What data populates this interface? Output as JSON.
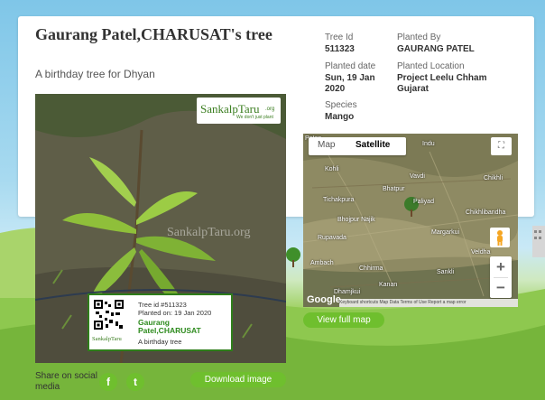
{
  "page": {
    "title": "Gaurang Patel,CHARUSAT's tree",
    "subtitle": "A birthday tree for Dhyan"
  },
  "details": {
    "tree_id_label": "Tree Id",
    "tree_id_value": "511323",
    "planted_by_label": "Planted By",
    "planted_by_value": "GAURANG PATEL",
    "planted_date_label": "Planted date",
    "planted_date_value_1": "Sun, 19 Jan",
    "planted_date_value_2": "2020",
    "planted_location_label": "Planted Location",
    "planted_location_value_1": "Project Leelu Chham",
    "planted_location_value_2": "Gujarat",
    "species_label": "Species",
    "species_value": "Mango"
  },
  "photo": {
    "logo_text": "SankalpTaru",
    "logo_tld": ".org",
    "logo_tagline": "We don't just plant",
    "watermark": "SankalpTaru.org"
  },
  "tag": {
    "tree_id": "Tree id #511323",
    "planted_on": "Planted on: 19 Jan 2020",
    "name": "Gaurang Patel,CHARUSAT",
    "occasion": "A birthday tree",
    "logo": "SankalpTaru"
  },
  "map": {
    "tab_map": "Map",
    "tab_satellite": "Satellite",
    "fullscreen_icon": "⛶",
    "zoom_in": "+",
    "zoom_out": "−",
    "google": "Google",
    "footer": "Keyboard shortcuts   Map Data   Terms of Use   Report a map error",
    "labels": [
      {
        "text": "Patan"
      },
      {
        "text": "Kohli"
      },
      {
        "text": "Vavdi"
      },
      {
        "text": "Bhatpur"
      },
      {
        "text": "Tichakpura"
      },
      {
        "text": "Paliyad"
      },
      {
        "text": "Bhojpur Najik"
      },
      {
        "text": "Chikhlibandha"
      },
      {
        "text": "Rupavada"
      },
      {
        "text": "Margarkui"
      },
      {
        "text": "Ambach"
      },
      {
        "text": "Chhirma"
      },
      {
        "text": "Sankli"
      },
      {
        "text": "Kanan"
      },
      {
        "text": "Dhamjkui"
      },
      {
        "text": "Veldha"
      },
      {
        "text": "Chikhli"
      },
      {
        "text": "Indu"
      }
    ]
  },
  "actions": {
    "view_full_map": "View full map",
    "share_label": "Share on social media",
    "facebook": "f",
    "twitter": "t",
    "download_image": "Download image"
  },
  "colors": {
    "accent": "#6fbf2e",
    "tag_border": "#2e7d1a"
  }
}
